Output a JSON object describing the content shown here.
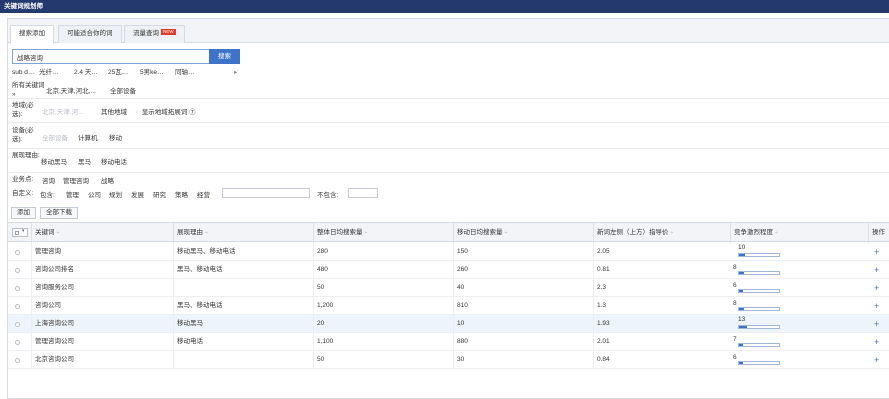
{
  "window": {
    "title": "关键词规划师"
  },
  "tabs": [
    {
      "label": "搜索添加",
      "active": true
    },
    {
      "label": "可能适合你的词",
      "active": false
    },
    {
      "label": "流量查询",
      "active": false,
      "badge": "NEW"
    }
  ],
  "search": {
    "value": "战略咨询",
    "button_label": "搜索"
  },
  "suggestions": [
    "sub d…",
    "光纤…",
    "2.4 天…",
    "25瓦…",
    "5男ke…",
    "同轴…"
  ],
  "suggest_more": "▸",
  "filters": {
    "keyword_source": {
      "label": "所有关键词 »",
      "options": [
        "北京,天津,河北,...",
        "全部设备"
      ]
    },
    "region": {
      "label": "地域(必选):",
      "options": [
        "北京,天津,河...",
        "其他地域"
      ],
      "extra": "显示地域拓展词 ⑦"
    },
    "device": {
      "label": "设备(必选):",
      "options": [
        "全部设备",
        "计算机",
        "移动"
      ]
    },
    "display_reason": {
      "label": "展现理由:",
      "options": [
        "移动黑马",
        "黑马",
        "移动电话"
      ]
    },
    "business_points": {
      "label": "业务点:",
      "options": [
        "咨询",
        "管理咨询",
        "战略"
      ]
    },
    "custom": {
      "label": "自定义:",
      "include_label": "包含:",
      "options": [
        "管理",
        "公司",
        "规划",
        "发展",
        "研究",
        "策略",
        "经营"
      ],
      "exclude_label": "不包含:"
    }
  },
  "toolbar": {
    "add_label": "添加",
    "download_label": "全部下载"
  },
  "table": {
    "columns": [
      "关键词",
      "展现理由",
      "整体日均搜索量",
      "移动日均搜索量",
      "新词左侧（上方）指导价",
      "竞争激烈程度",
      "操作"
    ],
    "rows": [
      {
        "keyword": "管理咨询",
        "reason": "移动黑马、移动电话",
        "total": "280",
        "mobile": "150",
        "price": "2.05",
        "competition": 10
      },
      {
        "keyword": "咨询公司排名",
        "reason": "黑马、移动电话",
        "total": "480",
        "mobile": "260",
        "price": "0.81",
        "competition": 8
      },
      {
        "keyword": "咨询服务公司",
        "reason": "",
        "total": "50",
        "mobile": "40",
        "price": "2.3",
        "competition": 6
      },
      {
        "keyword": "咨询公司",
        "reason": "黑马、移动电话",
        "total": "1,200",
        "mobile": "810",
        "price": "1.3",
        "competition": 8
      },
      {
        "keyword": "上海咨询公司",
        "reason": "移动黑马",
        "total": "20",
        "mobile": "10",
        "price": "1.93",
        "competition": 13
      },
      {
        "keyword": "管理咨询公司",
        "reason": "移动电话",
        "total": "1,100",
        "mobile": "880",
        "price": "2.01",
        "competition": 7
      },
      {
        "keyword": "北京咨询公司",
        "reason": "",
        "total": "50",
        "mobile": "30",
        "price": "0.84",
        "competition": 6
      }
    ],
    "action_symbol": "+",
    "sort_symbol": "÷"
  },
  "colors": {
    "titlebar": "#243a6e",
    "accent": "#3d73c8",
    "badge": "#e23b2a",
    "highlight_row": "#eef4fc"
  }
}
